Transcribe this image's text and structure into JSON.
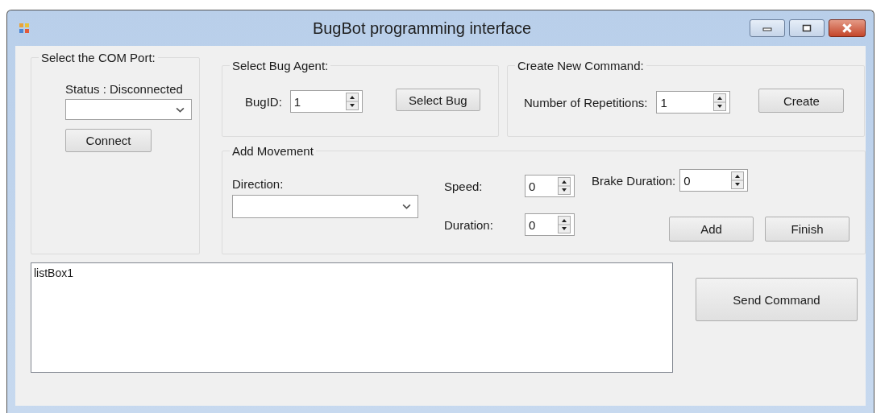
{
  "window": {
    "title": "BugBot programming interface"
  },
  "com_port": {
    "title": "Select the COM Port:",
    "status": "Status : Disconnected",
    "connect_button": "Connect"
  },
  "bug_agent": {
    "title": "Select Bug Agent:",
    "bug_id_label": "BugID:",
    "bug_id": "1",
    "select_button": "Select Bug"
  },
  "new_command": {
    "title": "Create New Command:",
    "repetitions_label": "Number of Repetitions:",
    "repetitions": "1",
    "create_button": "Create"
  },
  "movement": {
    "title": "Add Movement",
    "direction_label": "Direction:",
    "speed_label": "Speed:",
    "speed": "0",
    "duration_label": "Duration:",
    "duration": "0",
    "brake_label": "Brake Duration:",
    "brake": "0",
    "add_button": "Add",
    "finish_button": "Finish"
  },
  "list_box": {
    "items": [
      "listBox1"
    ]
  },
  "send_button": "Send Command"
}
